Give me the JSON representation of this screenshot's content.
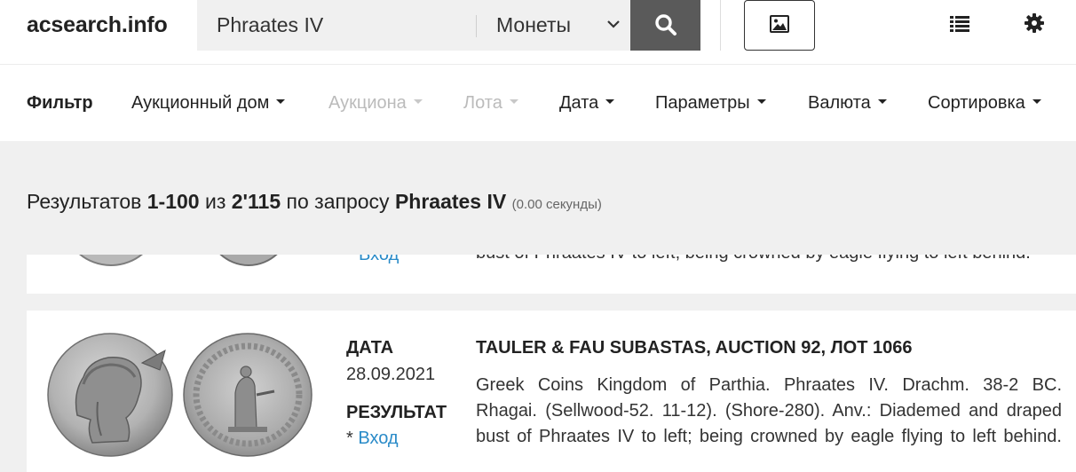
{
  "header": {
    "logo": "acsearch.info",
    "search_value": "Phraates IV",
    "category_selected": "Монеты",
    "colors": {
      "search_button_bg": "#5a5a5a",
      "link": "#2a8bc8"
    }
  },
  "filters": {
    "label": "Фильтр",
    "items": [
      {
        "label": "Аукционный дом",
        "enabled": true
      },
      {
        "label": "Аукциона",
        "enabled": false
      },
      {
        "label": "Лота",
        "enabled": false
      },
      {
        "label": "Дата",
        "enabled": true
      },
      {
        "label": "Параметры",
        "enabled": true
      },
      {
        "label": "Валюта",
        "enabled": true
      },
      {
        "label": "Сортировка",
        "enabled": true
      }
    ]
  },
  "summary": {
    "prefix": "Результатов",
    "range": "1-100",
    "of_word": "из",
    "total": "2'115",
    "query_word": "по запросу",
    "query": "Phraates IV",
    "time": "(0.00 секунды)"
  },
  "results": [
    {
      "login_text": "Вход",
      "desc_tail": "bust of Phraates IV to left; being crowned by eagle flying to left behind."
    },
    {
      "date_label": "ДАТА",
      "date": "28.09.2021",
      "result_label": "РЕЗУЛЬТАТ",
      "result_prefix": "*",
      "login_text": "Вход",
      "title": "TAULER & FAU SUBASTAS, AUCTION 92, ЛОТ 1066",
      "desc_lines": [
        "Greek Coins Kingdom of Parthia. Phraates IV. Drachm. 38-2 BC.",
        "Rhagai. (Sellwood-52. 11-12). (Shore-280). Anv.: Diademed and draped",
        "bust of Phraates IV to left; being crowned by eagle flying to left behind."
      ]
    }
  ]
}
